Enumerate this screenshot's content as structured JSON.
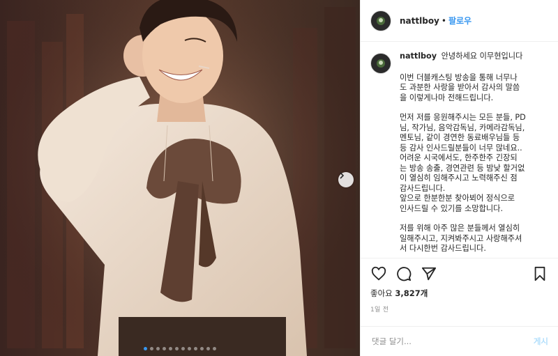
{
  "header": {
    "username": "nattlboy",
    "separator": "•",
    "follow_label": "팔로우"
  },
  "caption": {
    "username": "nattlboy",
    "first_line": "안녕하세요 이무현입니다",
    "paragraphs": [
      [
        "이번 더블캐스팅 방송을 통해 너무나",
        "도 과분한 사랑을 받아서 감사의 말씀",
        "을 이렇게나마 전해드립니다."
      ],
      [
        "먼저 저를 응원해주시는 모든 분들, PD",
        "님, 작가님, 음악감독님, 카메라감독님,",
        "멘토님, 같이 경연한 동료배우님들 등",
        "등 감사 인사드릴분들이 너무 많네요..",
        "어려운 시국에서도, 한주한주 긴장되",
        "는 방송 송출, 경연관련 등 밤낮 할거없",
        "이 열심히 임해주시고 노력해주신 점",
        "감사드립니다.",
        "앞으로 한분한분 찾아뵈어 정식으로",
        "인사드릴 수 있기를 소망합니다."
      ],
      [
        "저를 위해 아주 많은 분들께서 열심히",
        "일해주시고, 지켜봐주시고 사랑해주셔",
        "서 다시한번 감사드립니다."
      ]
    ]
  },
  "actions": {
    "like_icon": "heart-icon",
    "comment_icon": "comment-icon",
    "share_icon": "share-icon",
    "save_icon": "bookmark-icon"
  },
  "likes": {
    "label": "좋아요",
    "count": "3,827개"
  },
  "time": "1일 전",
  "comment_input": {
    "placeholder": "댓글 달기...",
    "post_label": "게시"
  },
  "carousel": {
    "dot_count": 12,
    "active_index": 0
  },
  "colors": {
    "accent": "#3897f0",
    "post_disabled": "#b2dffc",
    "muted": "#8e8e8e",
    "border": "#efefef"
  }
}
